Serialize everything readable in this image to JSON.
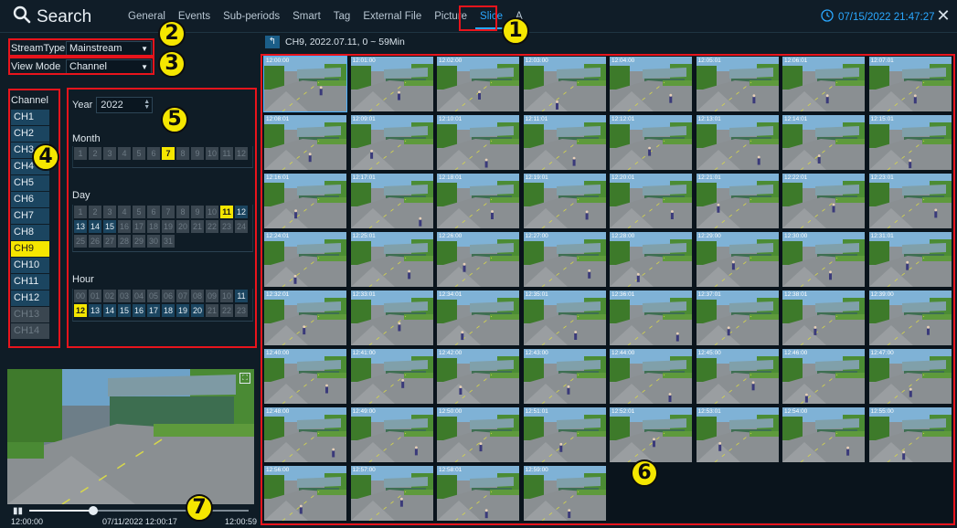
{
  "header": {
    "title": "Search",
    "tabs": [
      {
        "label": "General",
        "active": false
      },
      {
        "label": "Events",
        "active": false
      },
      {
        "label": "Sub-periods",
        "active": false
      },
      {
        "label": "Smart",
        "active": false
      },
      {
        "label": "Tag",
        "active": false
      },
      {
        "label": "External File",
        "active": false
      },
      {
        "label": "Picture",
        "active": false
      },
      {
        "label": "Slice",
        "active": true
      },
      {
        "label": "A",
        "active": false
      }
    ],
    "datetime": "07/15/2022 21:47:27"
  },
  "filters": {
    "stream_type": {
      "label": "StreamType",
      "value": "Mainstream"
    },
    "view_mode": {
      "label": "View Mode",
      "value": "Channel"
    }
  },
  "channels": {
    "title": "Channel",
    "items": [
      {
        "label": "CH1",
        "state": "on"
      },
      {
        "label": "CH2",
        "state": "on"
      },
      {
        "label": "CH3",
        "state": "on"
      },
      {
        "label": "CH4",
        "state": "on"
      },
      {
        "label": "CH5",
        "state": "on"
      },
      {
        "label": "CH6",
        "state": "on"
      },
      {
        "label": "CH7",
        "state": "on"
      },
      {
        "label": "CH8",
        "state": "on"
      },
      {
        "label": "CH9",
        "state": "selected"
      },
      {
        "label": "CH10",
        "state": "on"
      },
      {
        "label": "CH11",
        "state": "on"
      },
      {
        "label": "CH12",
        "state": "on"
      },
      {
        "label": "CH13",
        "state": "off"
      },
      {
        "label": "CH14",
        "state": "off"
      }
    ]
  },
  "date_picker": {
    "year_label": "Year",
    "year": "2022",
    "month_label": "Month",
    "months": {
      "labels": [
        "1",
        "2",
        "3",
        "4",
        "5",
        "6",
        "7",
        "8",
        "9",
        "10",
        "11",
        "12"
      ],
      "active": [],
      "current": "7"
    },
    "day_label": "Day",
    "days": {
      "labels": [
        "1",
        "2",
        "3",
        "4",
        "5",
        "6",
        "7",
        "8",
        "9",
        "10",
        "11",
        "12",
        "13",
        "14",
        "15",
        "16",
        "17",
        "18",
        "19",
        "20",
        "21",
        "22",
        "23",
        "24",
        "25",
        "26",
        "27",
        "28",
        "29",
        "30",
        "31"
      ],
      "active": [
        "12",
        "13",
        "14",
        "15"
      ],
      "current": "11"
    },
    "hour_label": "Hour",
    "hours": {
      "labels": [
        "00",
        "01",
        "02",
        "03",
        "04",
        "05",
        "06",
        "07",
        "08",
        "09",
        "10",
        "11",
        "12",
        "13",
        "14",
        "15",
        "16",
        "17",
        "18",
        "19",
        "20",
        "21",
        "22",
        "23"
      ],
      "active": [
        "11",
        "13",
        "14",
        "15",
        "16",
        "17",
        "18",
        "19",
        "20"
      ],
      "current": "12"
    }
  },
  "playback": {
    "start": "12:00:00",
    "current": "07/11/2022 12:00:17",
    "end": "12:00:59",
    "progress": 0.29
  },
  "breadcrumb": {
    "text": "CH9,  2022.07.11,  0 ~ 59Min"
  },
  "thumbnails": [
    "12:00:00",
    "12:01:00",
    "12:02:00",
    "12:03:00",
    "12:04:00",
    "12:05:01",
    "12:06:01",
    "12:07:01",
    "12:08:01",
    "12:09:01",
    "12:10:01",
    "12:11:01",
    "12:12:01",
    "12:13:01",
    "12:14:01",
    "12:15:01",
    "12:16:01",
    "12:17:01",
    "12:18:01",
    "12:19:01",
    "12:20:01",
    "12:21:01",
    "12:22:01",
    "12:23:01",
    "12:24:01",
    "12:25:01",
    "12:26:00",
    "12:27:00",
    "12:28:00",
    "12:29:00",
    "12:30:00",
    "12:31:01",
    "12:32:01",
    "12:33:01",
    "12:34:01",
    "12:35:01",
    "12:36:01",
    "12:37:01",
    "12:38:01",
    "12:39:00",
    "12:40:00",
    "12:41:00",
    "12:42:00",
    "12:43:00",
    "12:44:00",
    "12:45:00",
    "12:46:00",
    "12:47:00",
    "12:48:00",
    "12:49:00",
    "12:50:00",
    "12:51:01",
    "12:52:01",
    "12:53:01",
    "12:54:00",
    "12:55:00",
    "12:56:00",
    "12:57:00",
    "12:58:01",
    "12:59:00"
  ],
  "annotations": [
    "1",
    "2",
    "3",
    "4",
    "5",
    "6",
    "7"
  ],
  "colors": {
    "accent": "#2aa8ff",
    "selected": "#f5e600",
    "annotation_border": "#e8141c"
  },
  "icons": {
    "search": "search-icon",
    "clock": "clock-icon",
    "close": "close-icon",
    "back": "back-arrow-icon",
    "fullscreen": "fullscreen-icon",
    "pause": "pause-icon"
  }
}
